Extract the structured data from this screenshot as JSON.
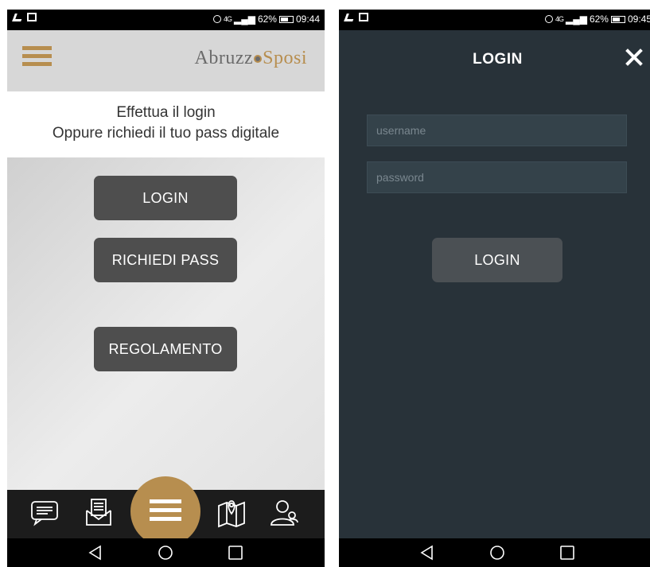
{
  "left": {
    "status": {
      "signal": "4G",
      "battery": "62%",
      "time": "09:44"
    },
    "header": {
      "logo_text_1": "Abruzz",
      "logo_text_2": "Sposi"
    },
    "intro": {
      "line1": "Effettua il login",
      "line2": "Oppure richiedi il tuo pass digitale"
    },
    "buttons": {
      "login": "LOGIN",
      "richiedi": "RICHIEDI PASS",
      "regolamento": "REGOLAMENTO"
    },
    "tabbar": {
      "icons": [
        "chat-icon",
        "mail-icon",
        "menu-icon",
        "map-icon",
        "users-icon"
      ]
    }
  },
  "right": {
    "status": {
      "signal": "4G",
      "battery": "62%",
      "time": "09:45"
    },
    "title": "LOGIN",
    "username_placeholder": "username",
    "password_placeholder": "password",
    "login_button": "LOGIN"
  },
  "colors": {
    "accent": "#b78e4f",
    "button": "#4e4e4e",
    "dark_bg": "#283239",
    "field_bg": "#34424a"
  }
}
